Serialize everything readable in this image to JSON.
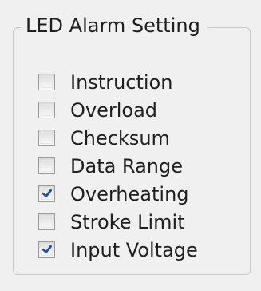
{
  "group": {
    "title": "LED Alarm Setting"
  },
  "options": [
    {
      "label": "Instruction",
      "checked": false
    },
    {
      "label": "Overload",
      "checked": false
    },
    {
      "label": "Checksum",
      "checked": false
    },
    {
      "label": "Data Range",
      "checked": false
    },
    {
      "label": "Overheating",
      "checked": true
    },
    {
      "label": "Stroke Limit",
      "checked": false
    },
    {
      "label": "Input Voltage",
      "checked": true
    }
  ]
}
